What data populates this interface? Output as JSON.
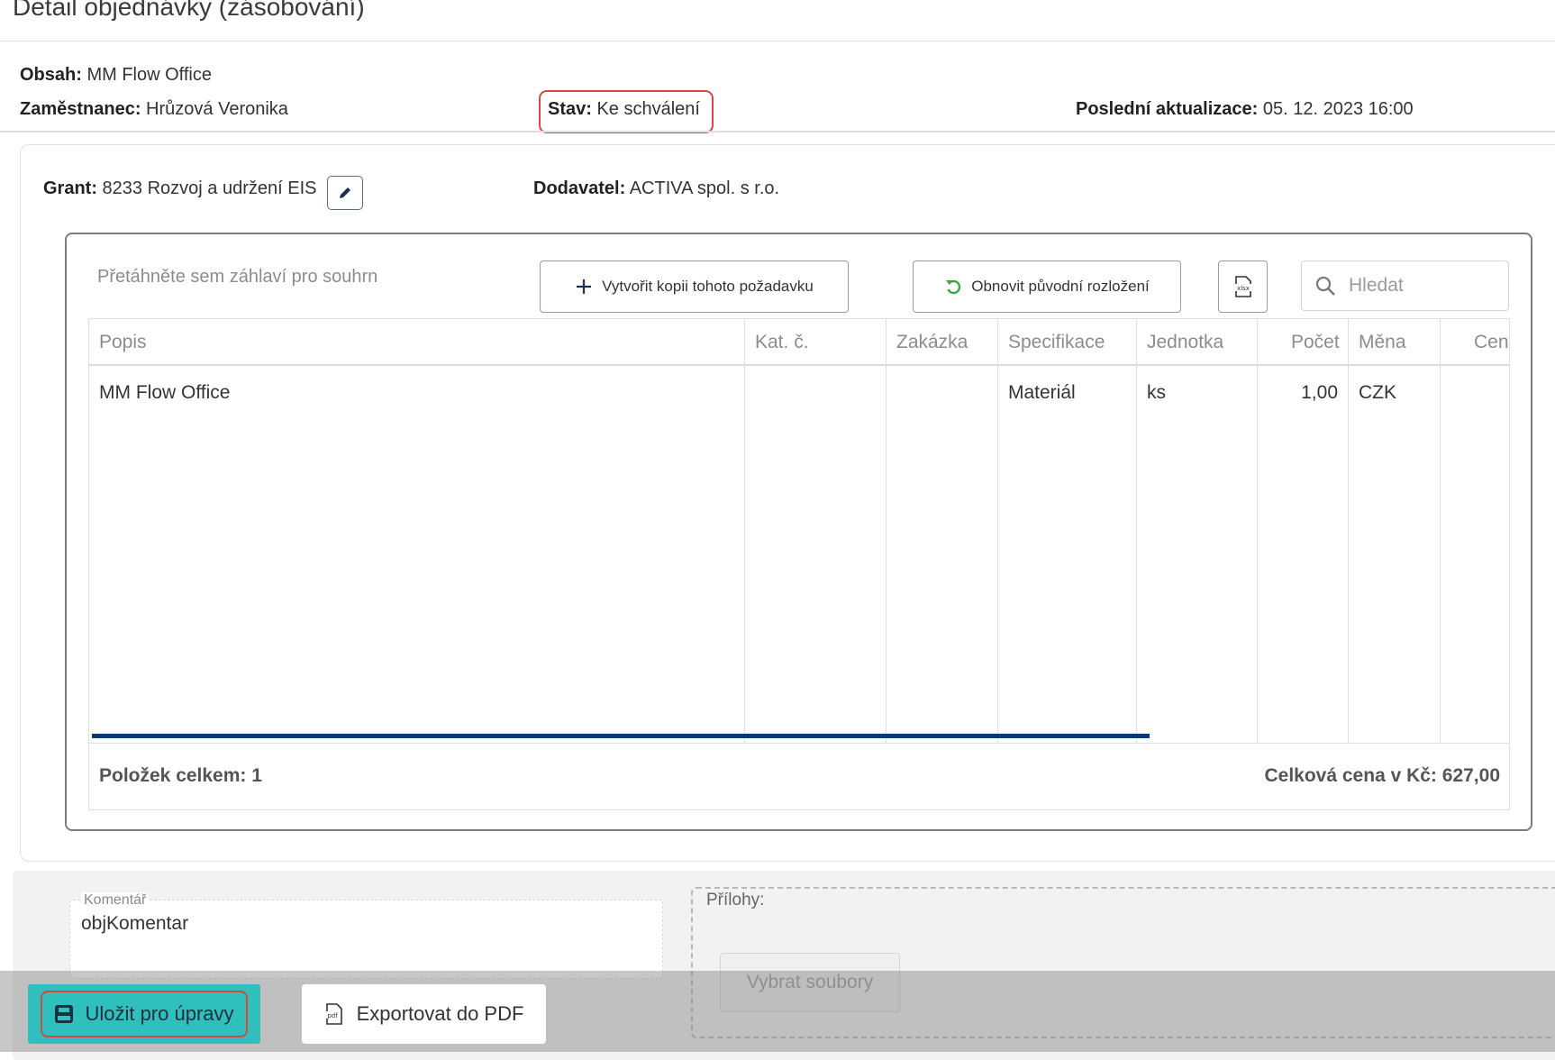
{
  "page": {
    "title": "Detail objednávky (zásobování)"
  },
  "order": {
    "obsah_label": "Obsah:",
    "obsah_value": " MM Flow Office",
    "zamestnanec_label": "Zaměstnanec:",
    "zamestnanec_value": " Hrůzová Veronika",
    "stav_label": "Stav:",
    "stav_value": " Ke schválení",
    "aktualizace_label": "Poslední aktualizace:",
    "aktualizace_value": " 05. 12. 2023 16:00",
    "grant_label": "Grant:",
    "grant_value": " 8233 Rozvoj a udržení EIS",
    "dodavatel_label": "Dodavatel:",
    "dodavatel_value": " ACTIVA spol. s r.o."
  },
  "grid": {
    "group_panel_text": "Přetáhněte sem záhlaví pro souhrn",
    "copy_button": "Vytvořit kopii tohoto požadavku",
    "reset_button": "Obnovit původní rozložení",
    "search_placeholder": "Hledat",
    "columns": [
      "Popis",
      "Kat. č.",
      "Zakázka",
      "Specifikace",
      "Jednotka",
      "Počet",
      "Měna",
      "Cen"
    ],
    "rows": [
      {
        "popis": "MM Flow Office",
        "kat": "",
        "zakazka": "",
        "specifikace": "Materiál",
        "jednotka": "ks",
        "pocet": "1,00",
        "mena": "CZK",
        "cena": ""
      }
    ],
    "footer_count": "Položek celkem: 1",
    "footer_total": "Celková cena v Kč: 627,00"
  },
  "bottom": {
    "komentar_label": "Komentář",
    "komentar_value": "objKomentar",
    "prilohy_label": "Přílohy:",
    "vybrat_button": "Vybrat soubory"
  },
  "actions": {
    "save_button": "Uložit pro úpravy",
    "pdf_button": "Exportovat do PDF"
  },
  "colors": {
    "highlight_border": "#d9473b",
    "save_button_bg": "#2fbfbd",
    "scrollbar": "#0d3a6c",
    "refresh_icon": "#3aa845"
  },
  "icons": [
    "pencil-icon",
    "plus-icon",
    "refresh-icon",
    "xlsx-export-icon",
    "search-icon",
    "save-disk-icon",
    "pdf-icon"
  ]
}
